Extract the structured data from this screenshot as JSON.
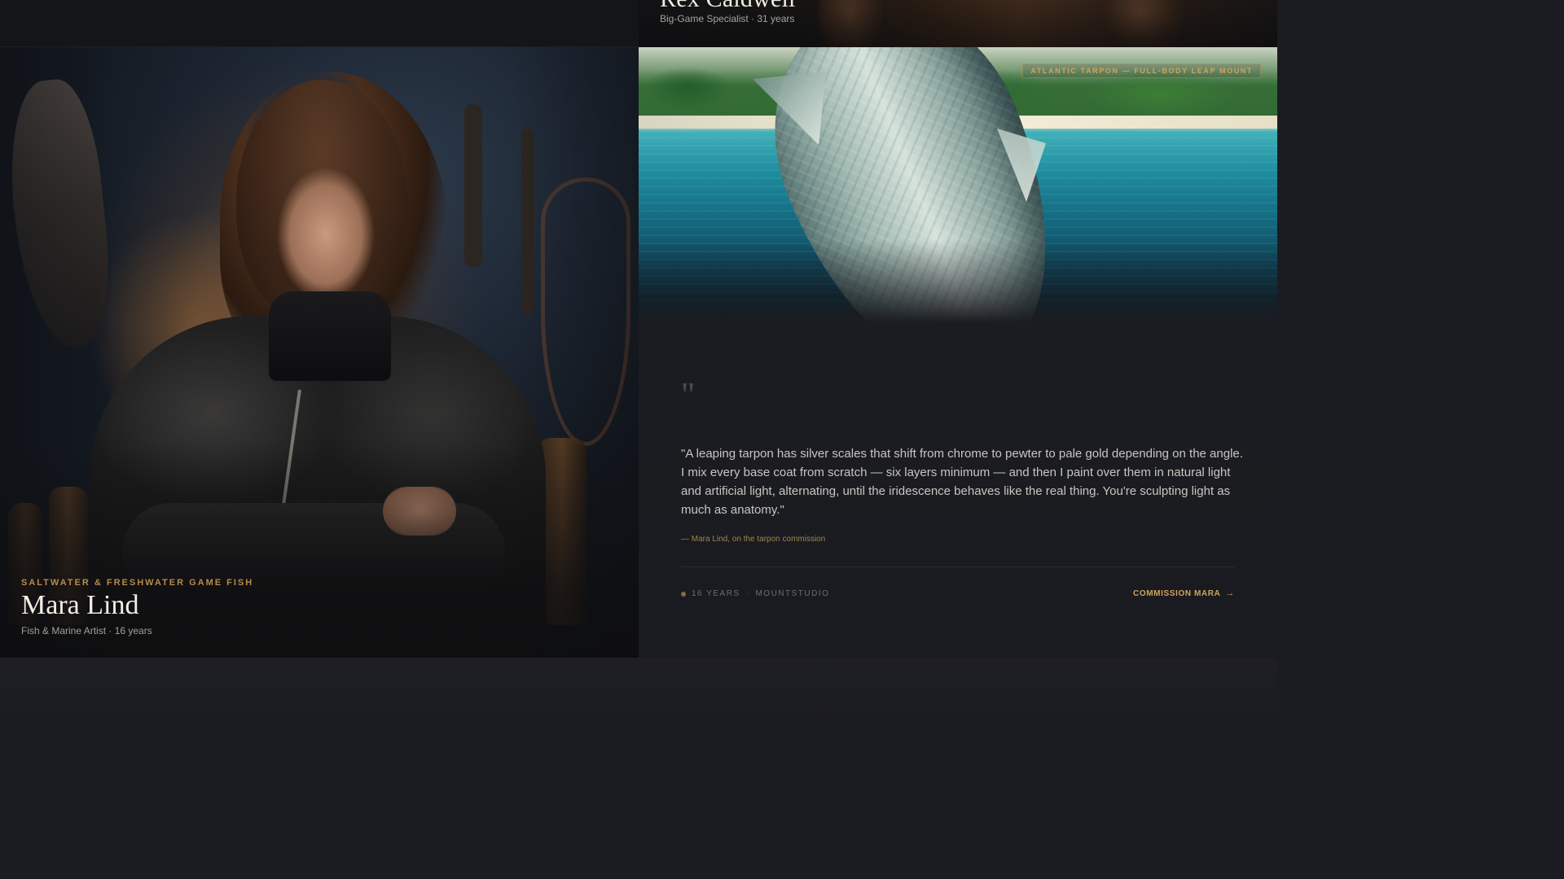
{
  "previous_card": {
    "name": "Rex Caldwell",
    "subtitle": "Big-Game Specialist · 31 years"
  },
  "featured_artist": {
    "specialty": "SALTWATER & FRESHWATER GAME FISH",
    "name": "Mara Lind",
    "subtitle": "Fish & Marine Artist · 16 years"
  },
  "commission_image": {
    "tag": "ATLANTIC TARPON — FULL-BODY LEAP MOUNT"
  },
  "quote": {
    "mark": "\"",
    "text": "\"A leaping tarpon has silver scales that shift from chrome to pewter to pale gold depending on the angle. I mix every base coat from scratch — six layers minimum — and then I paint over them in natural light and artificial light, alternating, until the iridescence behaves like the real thing. You're sculpting light as much as anatomy.\"",
    "attribution": "— Mara Lind, on the tarpon commission"
  },
  "meta": {
    "years": "16 YEARS",
    "separator": "·",
    "studio": "MOUNTSTUDIO"
  },
  "cta": {
    "label": "COMMISSION MARA",
    "arrow": "→"
  },
  "colors": {
    "accent_gold": "#d2a35c",
    "background": "#1b1c21"
  }
}
